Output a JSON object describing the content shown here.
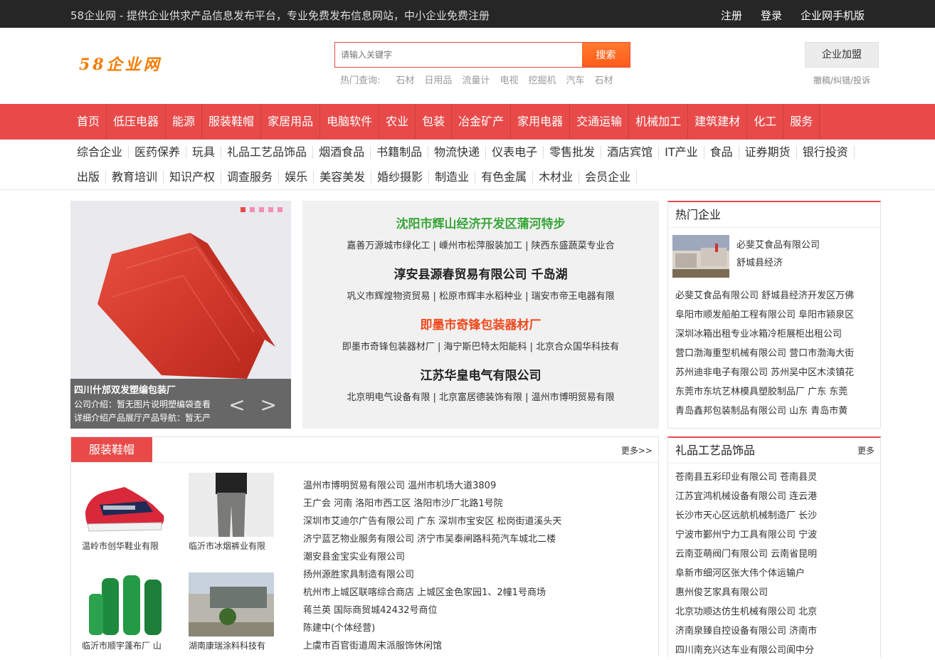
{
  "topbar": {
    "slogan": "58企业网 - 提供企业供求产品信息发布平台，专业免费发布信息网站，中小企业免费注册",
    "register": "注册",
    "login": "登录",
    "mobile": "企业网手机版"
  },
  "header": {
    "logo": "58企业网",
    "search_placeholder": "请输入关键字",
    "search_button": "搜索",
    "hot_label": "热门查询:",
    "hot_terms": [
      "石材",
      "日用品",
      "流量计",
      "电视",
      "挖掘机",
      "汽车",
      "石材"
    ],
    "join_button": "企业加盟",
    "complain": "撤稿/纠错/投诉"
  },
  "main_nav": [
    "首页",
    "低压电器",
    "能源",
    "服装鞋帽",
    "家居用品",
    "电脑软件",
    "农业",
    "包装",
    "冶金矿产",
    "家用电器",
    "交通运输",
    "机械加工",
    "建筑建材",
    "化工",
    "服务"
  ],
  "sub_nav_row1": [
    "综合企业",
    "医药保养",
    "玩具",
    "礼品工艺品饰品",
    "烟酒食品",
    "书籍制品",
    "物流快递",
    "仪表电子",
    "零售批发",
    "酒店宾馆",
    "IT产业",
    "食品",
    "证券期货",
    "银行投资"
  ],
  "sub_nav_row2": [
    "出版",
    "教育培训",
    "知识产权",
    "调查服务",
    "娱乐",
    "美容美发",
    "婚纱摄影",
    "制造业",
    "有色金属",
    "木材业",
    "会员企业"
  ],
  "banner": {
    "title": "四川什邡双发塑编包装厂",
    "line1": "公司介绍：暂无图片说明塑编袋查看",
    "line2": "详细介绍产品展厅产品导航：暂无产",
    "arrows": "< >"
  },
  "headlines": [
    {
      "title": "沈阳市辉山经济开发区蒲河特步",
      "color": "#3aa63a",
      "sub": "嘉善万源城市绿化工 | 嵊州市松萍服装加工 | 陕西东盛蔬菜专业合"
    },
    {
      "title": "淳安县源春贸易有限公司 千岛湖",
      "color": "#222222",
      "sub": "巩义市辉煌物资贸易 | 松原市辉丰水稻种业 | 瑞安市帝王电器有限"
    },
    {
      "title": "即墨市奇锋包装器材厂",
      "color": "#ef4a1c",
      "sub": "即墨市奇锋包装器材厂 | 海宁斯巴特太阳能科 | 北京合众国华科技有"
    },
    {
      "title": "江苏华皇电气有限公司",
      "color": "#222222",
      "sub": "北京明电气设备有限 | 北京富居德装饰有限 | 温州市博明贸易有限"
    }
  ],
  "hot_companies": {
    "title": "热门企业",
    "feature_name": "必斐艾食品有限公司",
    "feature_sub": "舒城县经济",
    "list": [
      "必斐艾食品有限公司 舒城县经济开发区万佛",
      "阜阳市顺发船舶工程有限公司 阜阳市颍泉区",
      "深圳冰箱出租专业冰箱冷柜展柜出租公司",
      "营口渤海重型机械有限公司 营口市渤海大街",
      "苏州迪非电子有限公司 苏州吴中区木渎镇花",
      "东莞市东坑艺林模具塑胶制品厂 广东 东莞",
      "青岛鑫邦包装制品有限公司 山东 青岛市黄"
    ]
  },
  "gifts": {
    "title": "礼品工艺品饰品",
    "more": "更多",
    "list": [
      "苍南县五彩印业有限公司 苍南县灵",
      "江苏宜鸿机械设备有限公司 连云港",
      "长沙市天心区远航机械制造厂 长沙",
      "宁波市鄞州宁力工具有限公司 宁波",
      "云南亚萌阀门有限公司 云南省昆明",
      "阜新市细河区张大伟个体运输户",
      "惠州俊艺家具有限公司",
      "北京功顺达仿生机械有限公司 北京",
      "济南泉臻自控设备有限公司 济南市",
      "四川南充兴达车业有限公司阆中分"
    ]
  },
  "clothing": {
    "title": "服装鞋帽",
    "more": "更多>>",
    "products": [
      {
        "name": "温岭市创华鞋业有限"
      },
      {
        "name": "临沂市冰烟裤业有限"
      },
      {
        "name": "临沂市顺宇蓬布厂 山"
      },
      {
        "name": "湖南康瑞涂料科技有"
      }
    ],
    "list": [
      "温州市博明贸易有限公司 温州市机场大道3809",
      "王广会 河南 洛阳市西工区 洛阳市沙厂北路1号院",
      "深圳市艾迪尔广告有限公司 广东 深圳市宝安区 松岗街道溪头天",
      "济宁蓝艺物业服务有限公司 济宁市吴泰闸路科苑汽车城北二楼",
      "潮安县金宝实业有限公司",
      "扬州源胜家具制造有限公司",
      "杭州市上城区联喀综合商店 上城区金色家园1、2幢1号商场",
      "蒋兰英 国际商贸城42432号商位",
      "陈建中(个体经营)",
      "上虞市百官街道周末派服饰休闲馆"
    ]
  }
}
